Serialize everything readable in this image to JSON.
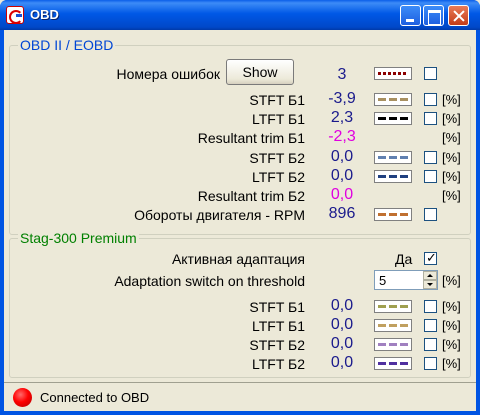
{
  "window": {
    "title": "OBD"
  },
  "colors": {
    "value_blue": "#1a1a8c",
    "value_pink": "#e000e0",
    "status_red": "#ff0000"
  },
  "obd": {
    "legend": "OBD II / EOBD",
    "errors": {
      "label": "Номера ошибок",
      "button": "Show",
      "value": "3",
      "swatch_color": "#8b0000"
    },
    "rows": [
      {
        "label": "STFT Б1",
        "value": "-3,9",
        "unit": "[%]",
        "swatch_color": "#a89060"
      },
      {
        "label": "LTFT Б1",
        "value": "2,3",
        "unit": "[%]",
        "swatch_color": "#000000"
      },
      {
        "label": "Resultant trim Б1",
        "value": "-2,3",
        "unit": "[%]"
      },
      {
        "label": "STFT Б2",
        "value": "0,0",
        "unit": "[%]",
        "swatch_color": "#6080b0"
      },
      {
        "label": "LTFT Б2",
        "value": "0,0",
        "unit": "[%]",
        "swatch_color": "#204080"
      },
      {
        "label": "Resultant trim Б2",
        "value": "0,0",
        "unit": "[%]"
      }
    ],
    "rpm": {
      "label": "Обороты двигателя - RPM",
      "value": "896",
      "swatch_color": "#c07030"
    }
  },
  "stag": {
    "legend": "Stag-300 Premium",
    "adaptive": {
      "label": "Активная адаптация",
      "value": "Да",
      "checked": "✓"
    },
    "threshold": {
      "label": "Adaptation switch on threshold",
      "value": "5",
      "unit": "[%]"
    },
    "rows": [
      {
        "label": "STFT Б1",
        "value": "0,0",
        "unit": "[%]",
        "swatch_color": "#a0a050"
      },
      {
        "label": "LTFT Б1",
        "value": "0,0",
        "unit": "[%]",
        "swatch_color": "#c0a060"
      },
      {
        "label": "STFT Б2",
        "value": "0,0",
        "unit": "[%]",
        "swatch_color": "#a080c0"
      },
      {
        "label": "LTFT Б2",
        "value": "0,0",
        "unit": "[%]",
        "swatch_color": "#5030a0"
      }
    ]
  },
  "status": {
    "text": "Connected to OBD"
  }
}
